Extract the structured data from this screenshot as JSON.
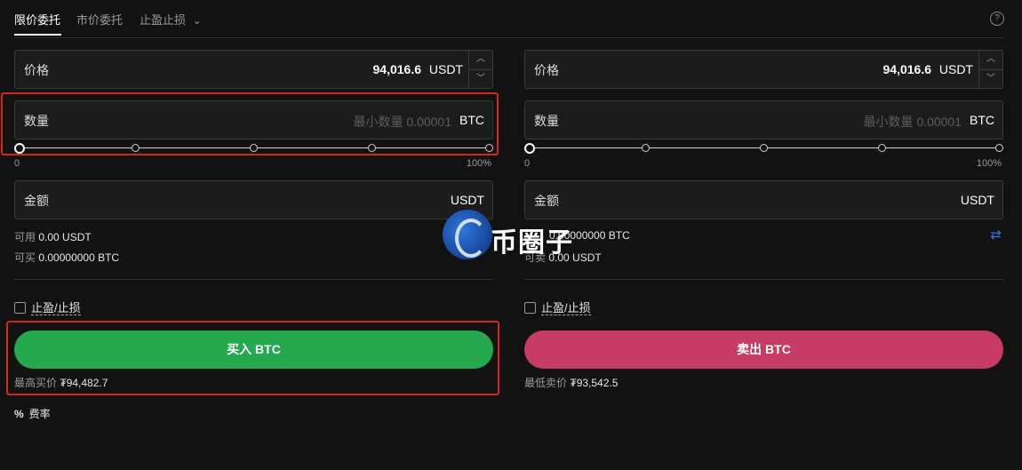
{
  "tabs": {
    "limit": "限价委托",
    "market": "市价委托",
    "tpsl": "止盈止损",
    "tpsl_chevron": "⌄",
    "help": "?"
  },
  "buy": {
    "price_label": "价格",
    "price_value": "94,016.6",
    "price_unit": "USDT",
    "qty_label": "数量",
    "qty_placeholder": "最小数量 0.00001",
    "qty_unit": "BTC",
    "slider_min": "0",
    "slider_max": "100%",
    "amount_label": "金额",
    "amount_unit": "USDT",
    "avail_label": "可用",
    "avail_value": "0.00 USDT",
    "can_label": "可买",
    "can_value": "0.00000000 BTC",
    "tpsl_label": "止盈/止损",
    "button_label": "买入 BTC",
    "best_label": "最高买价",
    "best_value": "₮94,482.7"
  },
  "sell": {
    "price_label": "价格",
    "price_value": "94,016.6",
    "price_unit": "USDT",
    "qty_label": "数量",
    "qty_placeholder": "最小数量 0.00001",
    "qty_unit": "BTC",
    "slider_min": "0",
    "slider_max": "100%",
    "amount_label": "金额",
    "amount_unit": "USDT",
    "avail_value": "0.00000000 BTC",
    "can_label": "可卖",
    "can_value": "0.00 USDT",
    "tpsl_label": "止盈/止损",
    "button_label": "卖出 BTC",
    "best_label": "最低卖价",
    "best_value": "₮93,542.5"
  },
  "fee": {
    "icon": "%",
    "label": "费率"
  },
  "watermark": {
    "text": "币圈子"
  },
  "icons": {
    "swap": "swap-icon",
    "help": "help-icon",
    "chevron": "chevron-down-icon"
  },
  "colors": {
    "buy": "#26a84f",
    "sell": "#c63c66",
    "highlight": "#d3271c",
    "accent": "#3b6fe0"
  }
}
